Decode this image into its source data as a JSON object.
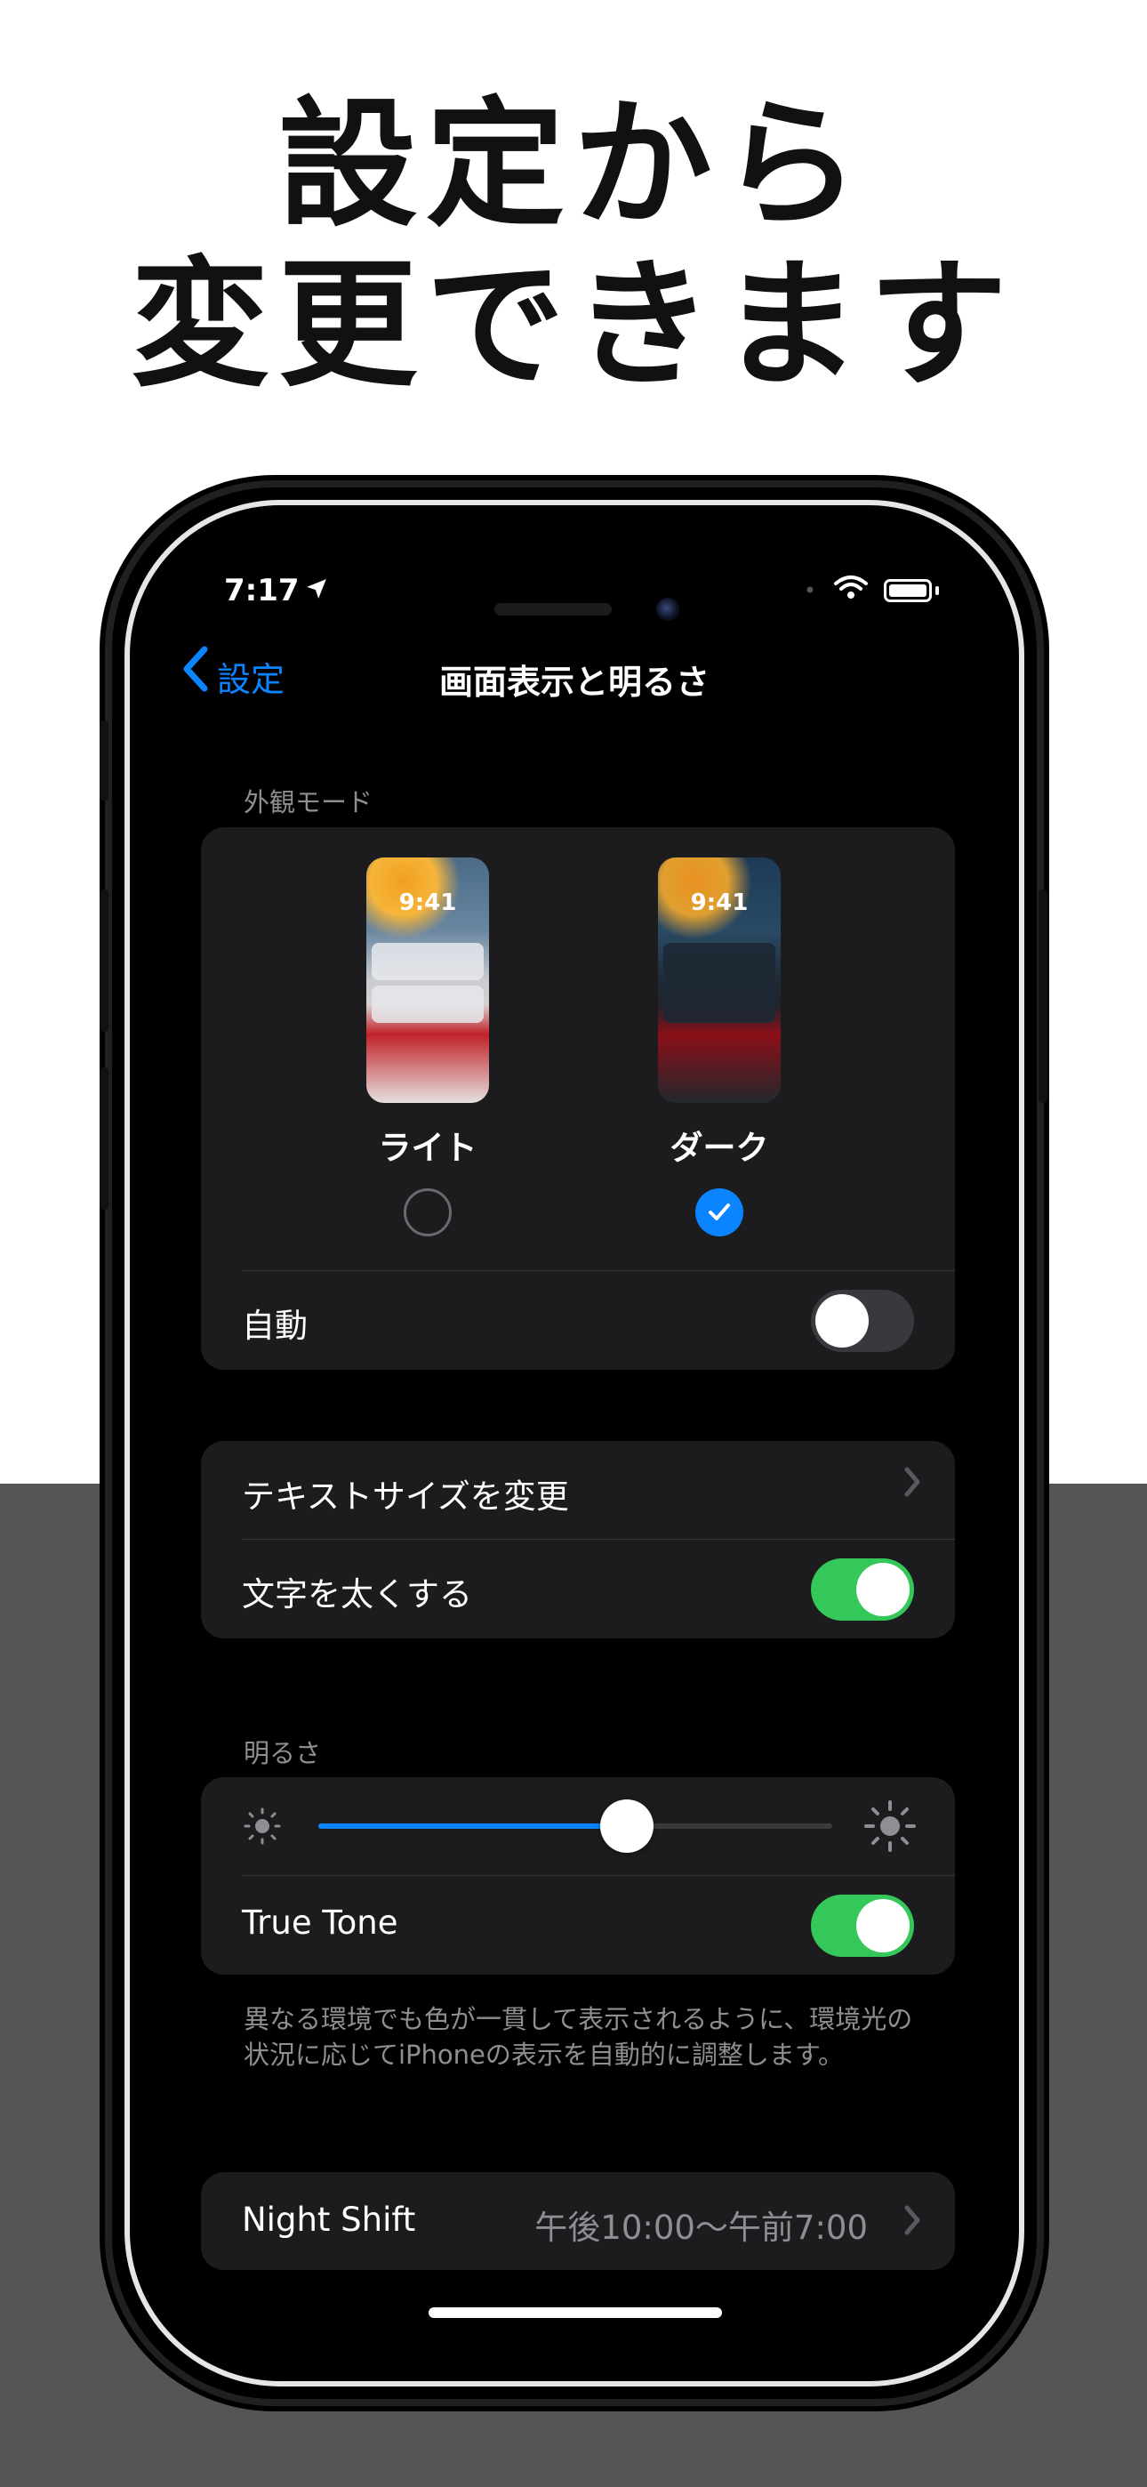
{
  "headline": {
    "line1": "設定から",
    "line2": "変更できます"
  },
  "status_bar": {
    "time": "7:17",
    "location_icon": "location-arrow-icon",
    "wifi_icon": "wifi-icon",
    "battery_icon": "battery-icon"
  },
  "nav": {
    "back_label": "設定",
    "title": "画面表示と明るさ"
  },
  "appearance": {
    "section_label": "外観モード",
    "light": {
      "label": "ライト",
      "preview_time": "9:41",
      "selected": false
    },
    "dark": {
      "label": "ダーク",
      "preview_time": "9:41",
      "selected": true
    },
    "auto_label": "自動",
    "auto_on": false
  },
  "text_group": {
    "text_size_label": "テキストサイズを変更",
    "bold_text_label": "文字を太くする",
    "bold_text_on": true
  },
  "brightness": {
    "section_label": "明るさ",
    "level": 0.6,
    "true_tone_label": "True Tone",
    "true_tone_on": true,
    "footnote": "異なる環境でも色が一貫して表示されるように、環境光の状況に応じてiPhoneの表示を自動的に調整します。"
  },
  "night_shift": {
    "label": "Night Shift",
    "value": "午後10:00〜午前7:00"
  },
  "colors": {
    "accent": "#0a84ff",
    "toggle_on": "#34c759",
    "cell_background": "#1c1c1e",
    "secondary_text": "#8e8e93"
  }
}
